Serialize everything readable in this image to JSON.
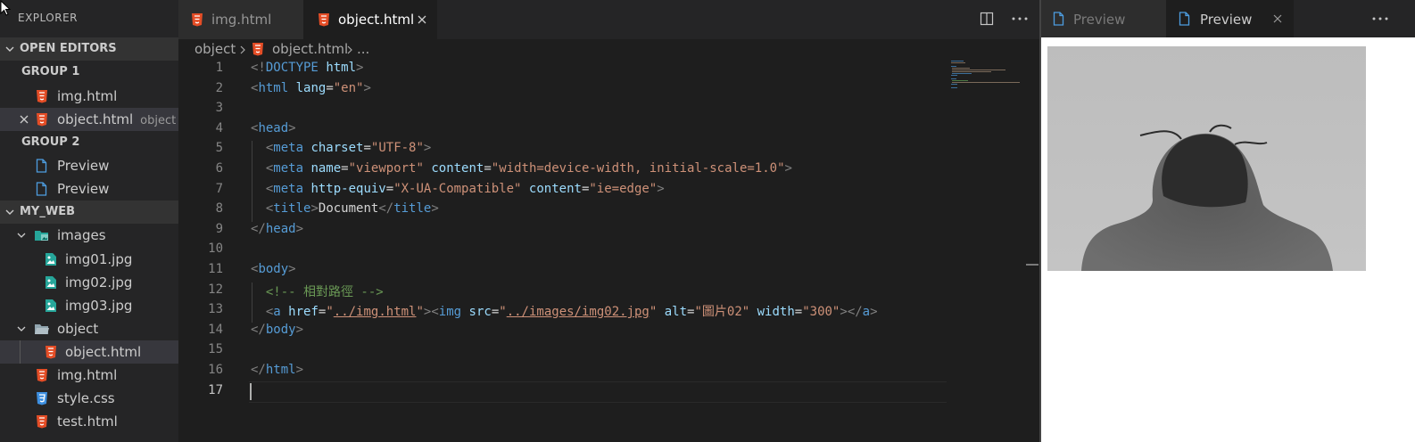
{
  "explorer": {
    "title": "EXPLORER",
    "open_editors": {
      "header": "OPEN EDITORS",
      "group1": {
        "label": "GROUP 1",
        "items": [
          {
            "label": "img.html"
          },
          {
            "label": "object.html",
            "description": "object"
          }
        ]
      },
      "group2": {
        "label": "GROUP 2",
        "items": [
          {
            "label": "Preview"
          },
          {
            "label": "Preview"
          }
        ]
      }
    },
    "workspace": {
      "header": "MY_WEB",
      "tree": [
        {
          "label": "images"
        },
        {
          "label": "img01.jpg"
        },
        {
          "label": "img02.jpg"
        },
        {
          "label": "img03.jpg"
        },
        {
          "label": "object"
        },
        {
          "label": "object.html"
        },
        {
          "label": "img.html"
        },
        {
          "label": "style.css"
        },
        {
          "label": "test.html"
        }
      ]
    }
  },
  "editor": {
    "tabs": [
      {
        "label": "img.html"
      },
      {
        "label": "object.html"
      }
    ],
    "breadcrumb": {
      "folder": "object",
      "file": "object.html",
      "more": "..."
    },
    "lines": [
      {
        "n": "1",
        "segs": [
          [
            "p",
            "<!"
          ],
          [
            "t",
            "DOCTYPE"
          ],
          [
            "x",
            " "
          ],
          [
            "a",
            "html"
          ],
          [
            "p",
            ">"
          ]
        ]
      },
      {
        "n": "2",
        "segs": [
          [
            "p",
            "<"
          ],
          [
            "t",
            "html"
          ],
          [
            "x",
            " "
          ],
          [
            "a",
            "lang"
          ],
          [
            "x",
            "="
          ],
          [
            "s",
            "\"en\""
          ],
          [
            "p",
            ">"
          ]
        ]
      },
      {
        "n": "3",
        "segs": []
      },
      {
        "n": "4",
        "segs": [
          [
            "p",
            "<"
          ],
          [
            "t",
            "head"
          ],
          [
            "p",
            ">"
          ]
        ]
      },
      {
        "n": "5",
        "segs": [
          [
            "x",
            "  "
          ],
          [
            "p",
            "<"
          ],
          [
            "t",
            "meta"
          ],
          [
            "x",
            " "
          ],
          [
            "a",
            "charset"
          ],
          [
            "x",
            "="
          ],
          [
            "s",
            "\"UTF-8\""
          ],
          [
            "p",
            ">"
          ]
        ]
      },
      {
        "n": "6",
        "segs": [
          [
            "x",
            "  "
          ],
          [
            "p",
            "<"
          ],
          [
            "t",
            "meta"
          ],
          [
            "x",
            " "
          ],
          [
            "a",
            "name"
          ],
          [
            "x",
            "="
          ],
          [
            "s",
            "\"viewport\""
          ],
          [
            "x",
            " "
          ],
          [
            "a",
            "content"
          ],
          [
            "x",
            "="
          ],
          [
            "s",
            "\"width=device-width, initial-scale=1.0\""
          ],
          [
            "p",
            ">"
          ]
        ]
      },
      {
        "n": "7",
        "segs": [
          [
            "x",
            "  "
          ],
          [
            "p",
            "<"
          ],
          [
            "t",
            "meta"
          ],
          [
            "x",
            " "
          ],
          [
            "a",
            "http-equiv"
          ],
          [
            "x",
            "="
          ],
          [
            "s",
            "\"X-UA-Compatible\""
          ],
          [
            "x",
            " "
          ],
          [
            "a",
            "content"
          ],
          [
            "x",
            "="
          ],
          [
            "s",
            "\"ie=edge\""
          ],
          [
            "p",
            ">"
          ]
        ]
      },
      {
        "n": "8",
        "segs": [
          [
            "x",
            "  "
          ],
          [
            "p",
            "<"
          ],
          [
            "t",
            "title"
          ],
          [
            "p",
            ">"
          ],
          [
            "x",
            "Document"
          ],
          [
            "p",
            "</"
          ],
          [
            "t",
            "title"
          ],
          [
            "p",
            ">"
          ]
        ]
      },
      {
        "n": "9",
        "segs": [
          [
            "p",
            "</"
          ],
          [
            "t",
            "head"
          ],
          [
            "p",
            ">"
          ]
        ]
      },
      {
        "n": "10",
        "segs": []
      },
      {
        "n": "11",
        "segs": [
          [
            "p",
            "<"
          ],
          [
            "t",
            "body"
          ],
          [
            "p",
            ">"
          ]
        ]
      },
      {
        "n": "12",
        "segs": [
          [
            "x",
            "  "
          ],
          [
            "c",
            "<!-- 相對路徑 -->"
          ]
        ]
      },
      {
        "n": "13",
        "segs": [
          [
            "x",
            "  "
          ],
          [
            "p",
            "<"
          ],
          [
            "t",
            "a"
          ],
          [
            "x",
            " "
          ],
          [
            "a",
            "href"
          ],
          [
            "x",
            "="
          ],
          [
            "s",
            "\""
          ],
          [
            "su",
            "../img.html"
          ],
          [
            "s",
            "\""
          ],
          [
            "p",
            ">"
          ],
          [
            "p",
            "<"
          ],
          [
            "t",
            "img"
          ],
          [
            "x",
            " "
          ],
          [
            "a",
            "src"
          ],
          [
            "x",
            "="
          ],
          [
            "s",
            "\""
          ],
          [
            "su",
            "../images/img02.jpg"
          ],
          [
            "s",
            "\""
          ],
          [
            "x",
            " "
          ],
          [
            "a",
            "alt"
          ],
          [
            "x",
            "="
          ],
          [
            "s",
            "\"圖片02\""
          ],
          [
            "x",
            " "
          ],
          [
            "a",
            "width"
          ],
          [
            "x",
            "="
          ],
          [
            "s",
            "\"300\""
          ],
          [
            "p",
            ">"
          ],
          [
            "p",
            "</"
          ],
          [
            "t",
            "a"
          ],
          [
            "p",
            ">"
          ]
        ]
      },
      {
        "n": "14",
        "segs": [
          [
            "p",
            "</"
          ],
          [
            "t",
            "body"
          ],
          [
            "p",
            ">"
          ]
        ]
      },
      {
        "n": "15",
        "segs": []
      },
      {
        "n": "16",
        "segs": [
          [
            "p",
            "</"
          ],
          [
            "t",
            "html"
          ],
          [
            "p",
            ">"
          ]
        ]
      },
      {
        "n": "17",
        "segs": []
      }
    ]
  },
  "preview": {
    "tabs": [
      {
        "label": "Preview"
      },
      {
        "label": "Preview"
      }
    ]
  },
  "colors": {
    "tag": "#569cd6",
    "punct": "#808080",
    "attr": "#9cdcfe",
    "string": "#ce9178",
    "comment": "#6a9955",
    "html_icon": "#e44d26",
    "css_icon": "#3d8fe0",
    "file_icon": "#4d9de0",
    "image_icon": "#26a69a"
  }
}
